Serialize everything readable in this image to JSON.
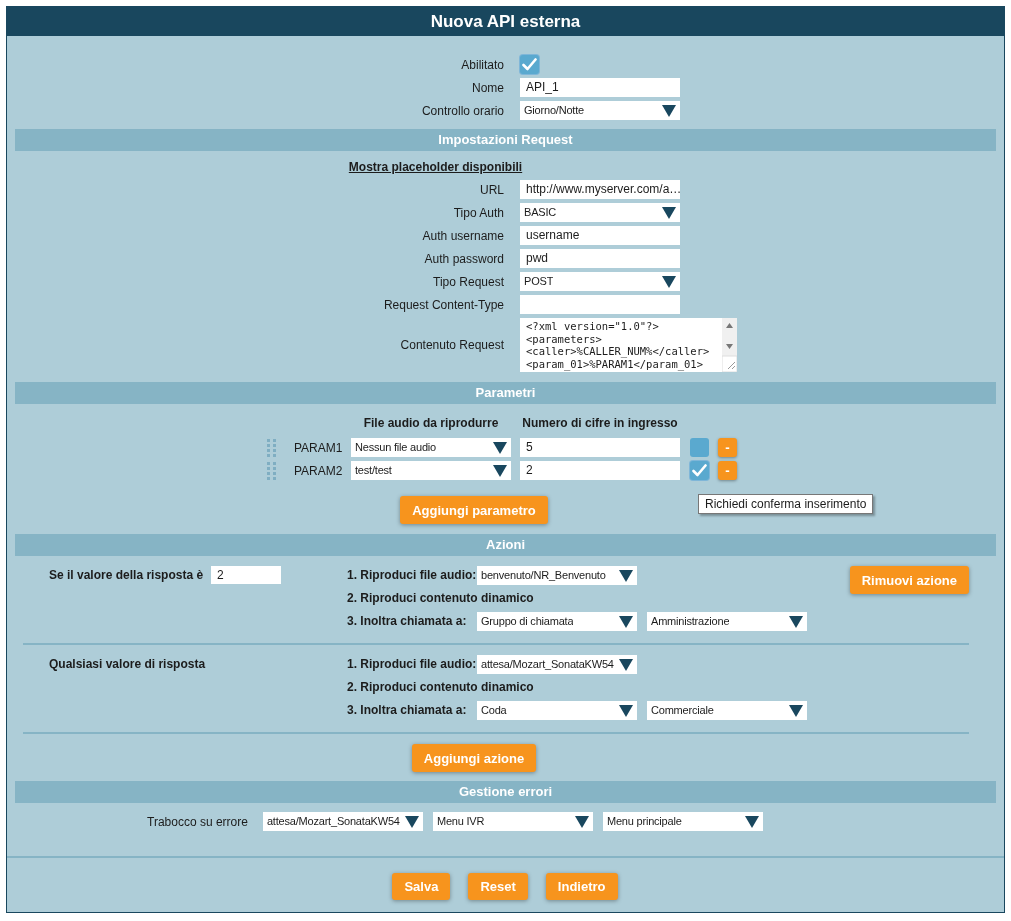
{
  "window": {
    "title": "Nuova API esterna"
  },
  "general": [
    {
      "kind": "checkbox",
      "label": "Abilitato",
      "checked": true
    },
    {
      "kind": "text",
      "label": "Nome",
      "value": "API_1"
    },
    {
      "kind": "select",
      "label": "Controllo orario",
      "value": "Giorno/Notte"
    }
  ],
  "request": {
    "heading": "Impostazioni Request",
    "link": "Mostra placeholder disponibili",
    "fields": [
      {
        "kind": "text",
        "label": "URL",
        "value": "http://www.myserver.com/a…"
      },
      {
        "kind": "select",
        "label": "Tipo Auth",
        "value": "BASIC"
      },
      {
        "kind": "text",
        "label": "Auth username",
        "value": "username"
      },
      {
        "kind": "text",
        "label": "Auth password",
        "value": "pwd"
      },
      {
        "kind": "select",
        "label": "Tipo Request",
        "value": "POST"
      },
      {
        "kind": "text",
        "label": "Request Content-Type"
      },
      {
        "kind": "textarea",
        "label": "Contenuto Request",
        "value": "<?xml version=\"1.0\"?>\n<parameters>\n<caller>%CALLER_NUM%</caller>\n<param_01>%PARAM1</param_01>"
      }
    ]
  },
  "parameters": {
    "heading": "Parametri",
    "columns": [
      "File audio da riprodurre",
      "Numero di cifre in ingresso"
    ],
    "rows": [
      {
        "name": "PARAM1",
        "audio": "Nessun file audio",
        "digits": "5",
        "confirm": false,
        "remove": "-"
      },
      {
        "name": "PARAM2",
        "audio": "test/test",
        "digits": "2",
        "confirm": true,
        "remove": "-"
      }
    ],
    "tooltip": "Richiedi conferma inserimento",
    "add_button": "Aggiungi parametro"
  },
  "actions": {
    "heading": "Azioni",
    "items": [
      {
        "kind": "value",
        "condition": "Se il valore della risposta è",
        "value": "2",
        "remove_button": "Rimuovi azione",
        "steps": [
          {
            "kind": "audio",
            "label": "1. Riproduci file audio:",
            "selects": [
              "benvenuto/NR_Benvenuto"
            ]
          },
          {
            "kind": "dynamic",
            "label": "2. Riproduci contenuto dinamico"
          },
          {
            "kind": "forward",
            "label": "3. Inoltra chiamata a:",
            "selects": [
              "Gruppo di chiamata",
              "Amministrazione"
            ]
          }
        ]
      },
      {
        "kind": "any",
        "condition": "Qualsiasi valore di risposta",
        "steps": [
          {
            "kind": "audio",
            "label": "1. Riproduci file audio:",
            "selects": [
              "attesa/Mozart_SonataKW54"
            ]
          },
          {
            "kind": "dynamic",
            "label": "2. Riproduci contenuto dinamico"
          },
          {
            "kind": "forward",
            "label": "3. Inoltra chiamata a:",
            "selects": [
              "Coda",
              "Commerciale"
            ]
          }
        ]
      }
    ],
    "add_button": "Aggiungi azione"
  },
  "errors": {
    "heading": "Gestione errori",
    "label": "Trabocco su errore",
    "selects": [
      "attesa/Mozart_SonataKW54",
      "Menu IVR",
      "Menu principale"
    ]
  },
  "buttons": [
    "Salva",
    "Reset",
    "Indietro"
  ]
}
